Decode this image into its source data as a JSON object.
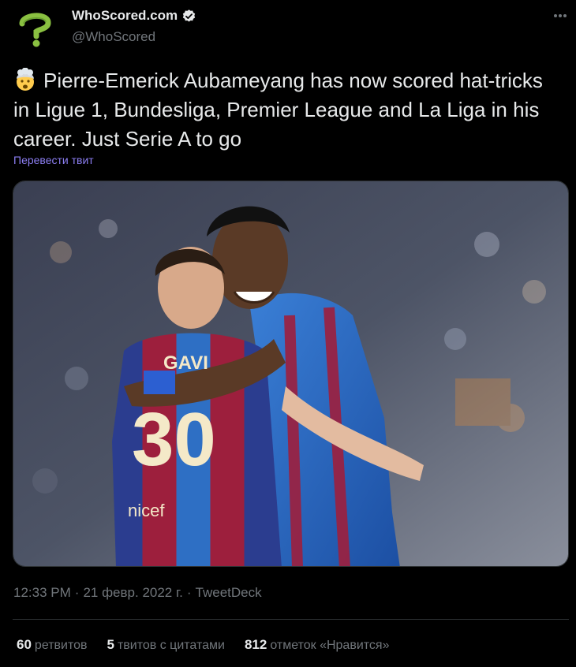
{
  "author": {
    "display_name": "WhoScored.com",
    "handle": "@WhoScored",
    "verified": true,
    "avatar_icon": "question-mark-logo-icon",
    "brand_color": "#8ac041"
  },
  "tweet": {
    "emoji": "exploding-head-emoji",
    "text": "Pierre-Emerick Aubameyang has now scored hat-tricks in Ligue 1, Bundesliga, Premier League and La Liga in his career. Just Serie A to go",
    "translate_label": "Перевести твит"
  },
  "media": {
    "shirt_name": "GAVI",
    "shirt_number": "30",
    "sponsor": "nicef"
  },
  "meta": {
    "time": "12:33 PM",
    "date": "21 февр. 2022 г.",
    "source": "TweetDeck"
  },
  "stats": {
    "retweets_count": "60",
    "retweets_label": "ретвитов",
    "quotes_count": "5",
    "quotes_label": "твитов с цитатами",
    "likes_count": "812",
    "likes_label": "отметок «Нравится»"
  },
  "colors": {
    "background": "#000000",
    "text_primary": "#e7e9ea",
    "text_secondary": "#71767b",
    "link": "#8c7ef2",
    "divider": "#2f3336"
  }
}
